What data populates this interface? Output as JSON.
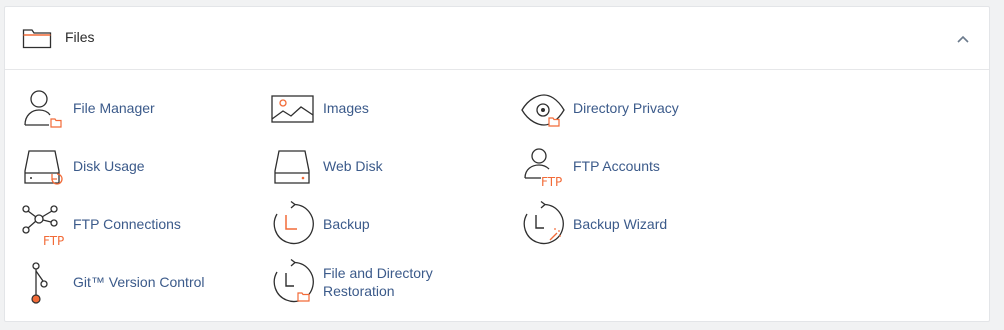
{
  "section": {
    "title": "Files",
    "icon": "folder-icon",
    "collapse_icon": "chevron-up-icon"
  },
  "items": [
    {
      "label": "File Manager",
      "icon": "file-manager-icon"
    },
    {
      "label": "Images",
      "icon": "images-icon"
    },
    {
      "label": "Directory Privacy",
      "icon": "directory-privacy-icon"
    },
    {
      "label": "Disk Usage",
      "icon": "disk-usage-icon"
    },
    {
      "label": "Web Disk",
      "icon": "web-disk-icon"
    },
    {
      "label": "FTP Accounts",
      "icon": "ftp-accounts-icon"
    },
    {
      "label": "FTP Connections",
      "icon": "ftp-connections-icon"
    },
    {
      "label": "Backup",
      "icon": "backup-icon"
    },
    {
      "label": "Backup Wizard",
      "icon": "backup-wizard-icon"
    },
    {
      "label": "Git™ Version Control",
      "icon": "git-version-control-icon"
    },
    {
      "label": "File and Directory Restoration",
      "icon": "restoration-icon"
    }
  ],
  "ftp_text": "FTP",
  "colors": {
    "accent": "#f26b38",
    "link": "#3b5a8a",
    "line": "#2f2f2f"
  }
}
